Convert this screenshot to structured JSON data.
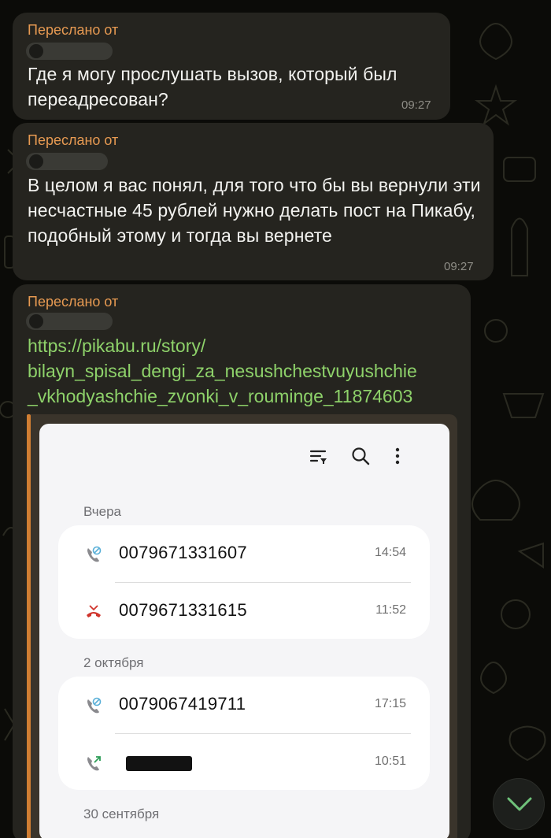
{
  "chat": {
    "messages": [
      {
        "forwarded_label": "Переслано от",
        "text": "Где я могу прослушать вызов, который был переадресован?",
        "time": "09:27"
      },
      {
        "forwarded_label": "Переслано от",
        "text": "В целом я вас понял, для того что бы вы вернули эти несчастные 45 рублей нужно делать пост на Пикабу, подобный этому и тогда вы вернете",
        "time": "09:27"
      },
      {
        "forwarded_label": "Переслано от",
        "link_lines": [
          "https://pikabu.ru/story/",
          "bilayn_spisal_dengi_za_nesushchestvuyushchie",
          "_vkhodyashchie_zvonki_v_rouminge_11874603"
        ]
      }
    ]
  },
  "call_log": {
    "sections": [
      {
        "label": "Вчера",
        "calls": [
          {
            "icon": "blocked-call-icon",
            "number": "0079671331607",
            "time": "14:54"
          },
          {
            "icon": "missed-call-icon",
            "number": "0079671331615",
            "time": "11:52"
          }
        ]
      },
      {
        "label": "2 октября",
        "calls": [
          {
            "icon": "blocked-call-icon",
            "number": "0079067419711",
            "time": "17:15"
          },
          {
            "icon": "outgoing-call-icon",
            "number": "",
            "time": "10:51"
          }
        ]
      },
      {
        "label": "30 сентября",
        "calls": []
      }
    ],
    "colors": {
      "missed": "#d0342c",
      "icon_gray": "#8a8a8e",
      "outgoing_arrow": "#2e9d57"
    }
  },
  "colors": {
    "forward_label": "#e79a52",
    "link": "#8ed26a",
    "bubble": "#25241f",
    "preview_accent": "#d07e33"
  }
}
